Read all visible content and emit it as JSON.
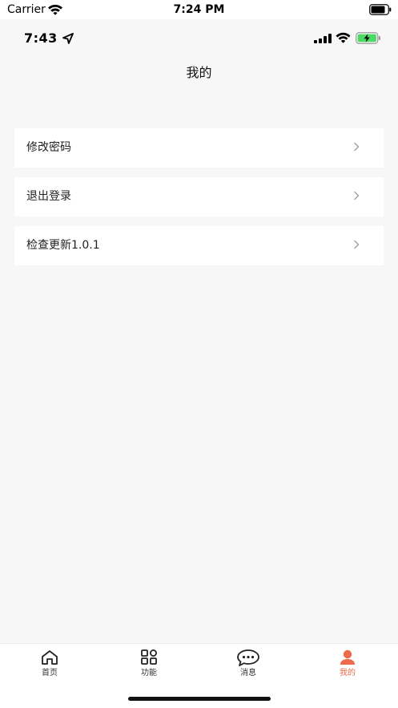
{
  "outer_status": {
    "carrier": "Carrier",
    "time": "7:24 PM"
  },
  "inner_status": {
    "time": "7:43"
  },
  "nav": {
    "title": "我的"
  },
  "menu": {
    "items": [
      {
        "label": "修改密码"
      },
      {
        "label": "退出登录"
      },
      {
        "label": "检查更新1.0.1"
      }
    ]
  },
  "tabbar": {
    "tabs": [
      {
        "label": "首页",
        "icon": "home-icon",
        "active": false
      },
      {
        "label": "功能",
        "icon": "grid-icon",
        "active": false
      },
      {
        "label": "消息",
        "icon": "chat-icon",
        "active": false
      },
      {
        "label": "我的",
        "icon": "person-icon",
        "active": true
      }
    ]
  },
  "colors": {
    "accent": "#ee6a4a",
    "background": "#f7f7f7",
    "battery_green": "#4cd964"
  }
}
